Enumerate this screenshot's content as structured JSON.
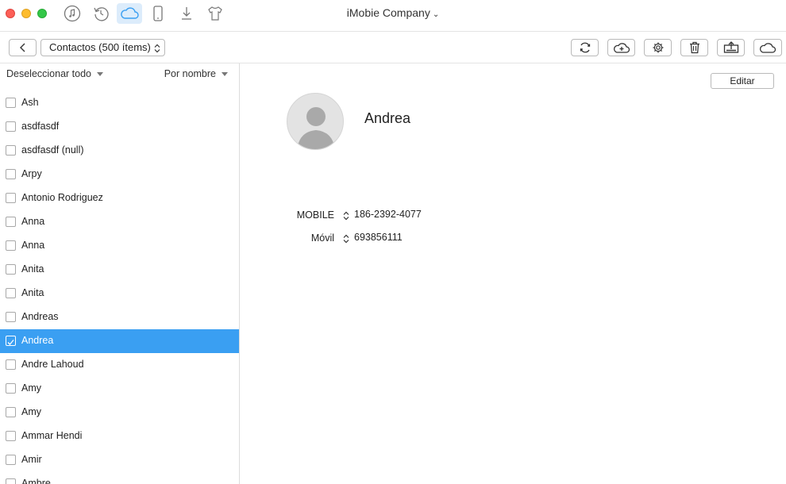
{
  "window": {
    "title": "iMobie Company"
  },
  "colors": {
    "selection": "#3a9ff2",
    "active_nav": "#dcecfb"
  },
  "nav_icons": [
    "music-icon",
    "restore-icon",
    "icloud-icon",
    "phone-icon",
    "download-icon",
    "shirt-icon"
  ],
  "toolbar": {
    "category_select": "Contactos (500 ítems)",
    "actions": [
      "refresh-icon",
      "cloud-add-icon",
      "gear-icon",
      "trash-icon",
      "export-icon",
      "cloud-icon"
    ]
  },
  "list": {
    "deselect_label": "Deseleccionar todo",
    "sort_label": "Por nombre",
    "contacts": [
      {
        "name": "Ash",
        "checked": false
      },
      {
        "name": "asdfasdf",
        "checked": false
      },
      {
        "name": "asdfasdf (null)",
        "checked": false
      },
      {
        "name": "Arpy",
        "checked": false
      },
      {
        "name": "Antonio Rodriguez",
        "checked": false
      },
      {
        "name": "Anna",
        "checked": false
      },
      {
        "name": "Anna",
        "checked": false
      },
      {
        "name": "Anita",
        "checked": false
      },
      {
        "name": "Anita",
        "checked": false
      },
      {
        "name": "Andreas",
        "checked": false
      },
      {
        "name": "Andrea",
        "checked": true
      },
      {
        "name": "Andre Lahoud",
        "checked": false
      },
      {
        "name": "Amy",
        "checked": false
      },
      {
        "name": "Amy",
        "checked": false
      },
      {
        "name": "Ammar Hendi",
        "checked": false
      },
      {
        "name": "Amir",
        "checked": false
      },
      {
        "name": "Ambre",
        "checked": false
      }
    ]
  },
  "detail": {
    "edit_label": "Editar",
    "name": "Andrea",
    "fields": [
      {
        "label": "MOBILE",
        "value": "186-2392-4077"
      },
      {
        "label": "Móvil",
        "value": "693856111"
      }
    ]
  }
}
